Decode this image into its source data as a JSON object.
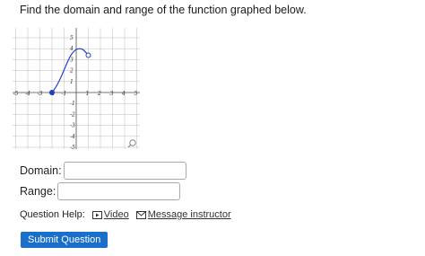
{
  "question": {
    "text": "Find the domain and range of the function graphed below."
  },
  "graph": {
    "x_tick_labels": [
      "-5",
      "-4",
      "-3",
      "-2",
      "-1",
      "1",
      "2",
      "3",
      "4",
      "5"
    ],
    "y_tick_labels": [
      "5",
      "4",
      "3",
      "2",
      "1",
      "-1",
      "-2",
      "-3",
      "-4",
      "-5"
    ],
    "colors": {
      "curve": "#1f3fbf",
      "grid": "#bcbcbc",
      "axis": "#555555"
    },
    "curve": {
      "start": {
        "x": -2,
        "y": 0,
        "closed": true
      },
      "peak": {
        "x": 0.3,
        "y": 4
      },
      "end": {
        "x": 1,
        "y": 3.4,
        "closed": false
      }
    },
    "zoom_icon": "magnifier-icon"
  },
  "form": {
    "domain_label": "Domain:",
    "domain_value": "",
    "range_label": "Range:",
    "range_value": ""
  },
  "help": {
    "label": "Question Help:",
    "video_link": "Video",
    "message_link": "Message instructor"
  },
  "submit_label": "Submit Question"
}
